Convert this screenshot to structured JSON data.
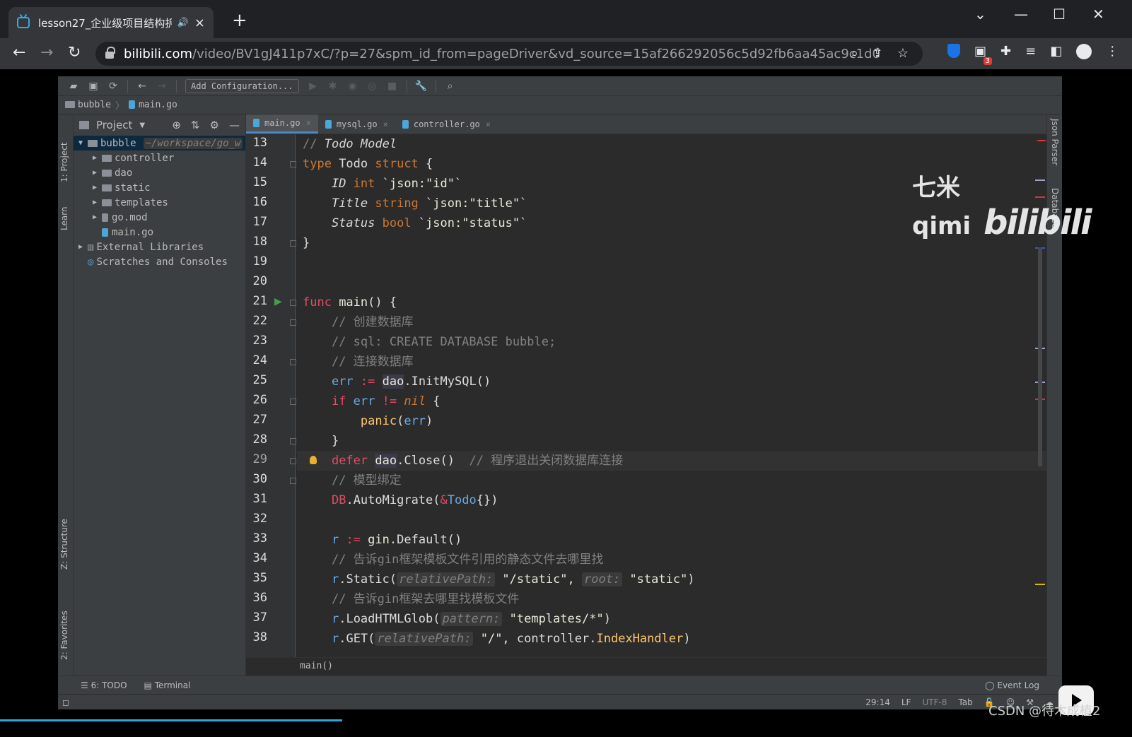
{
  "browser": {
    "tab_title": "lesson27_企业级项目结构拆",
    "new_tab": "+",
    "window_controls": [
      "chevron-down",
      "minimize",
      "maximize",
      "close"
    ],
    "url_host": "bilibili.com",
    "url_path": "/video/BV1gJ411p7xC/?p=27&spm_id_from=pageDriver&vd_source=15af266292056c5d92fb6aa45ac9c1d0",
    "extension_badge": "3"
  },
  "ide": {
    "toolbar": {
      "add_config": "Add Configuration..."
    },
    "breadcrumb": [
      "bubble",
      "main.go"
    ],
    "left_tool_labels": [
      "1: Project",
      "Learn",
      "Z: Structure",
      "2: Favorites"
    ],
    "right_tool_labels": [
      "Json Parser",
      "Database"
    ],
    "project_panel": {
      "title": "Project",
      "tree": [
        {
          "name": "bubble",
          "hint": "~/workspace/go_w",
          "indent": 0,
          "arrow": "▼",
          "type": "folder",
          "selected": true
        },
        {
          "name": "controller",
          "indent": 1,
          "arrow": "▶",
          "type": "folder"
        },
        {
          "name": "dao",
          "indent": 1,
          "arrow": "▶",
          "type": "folder"
        },
        {
          "name": "static",
          "indent": 1,
          "arrow": "▶",
          "type": "folder"
        },
        {
          "name": "templates",
          "indent": 1,
          "arrow": "▶",
          "type": "folder"
        },
        {
          "name": "go.mod",
          "indent": 1,
          "arrow": "▶",
          "type": "file"
        },
        {
          "name": "main.go",
          "indent": 1,
          "arrow": "",
          "type": "gofile"
        },
        {
          "name": "External Libraries",
          "indent": 0,
          "arrow": "▶",
          "type": "lib"
        },
        {
          "name": "Scratches and Consoles",
          "indent": 0,
          "arrow": "",
          "type": "scratch"
        }
      ]
    },
    "tabs": [
      {
        "label": "main.go",
        "active": true
      },
      {
        "label": "mysql.go",
        "active": false
      },
      {
        "label": "controller.go",
        "active": false
      }
    ],
    "code_lines": [
      {
        "num": "13",
        "tokens": [
          [
            "cmt",
            "// "
          ],
          [
            "cmt-i",
            "Todo Model"
          ]
        ]
      },
      {
        "num": "14",
        "tokens": [
          [
            "kw",
            "type "
          ],
          [
            "id",
            "Todo "
          ],
          [
            "kw",
            "struct "
          ],
          [
            "id",
            "{"
          ]
        ]
      },
      {
        "num": "15",
        "tokens": [
          [
            "id",
            "    "
          ],
          [
            "fld",
            "ID "
          ],
          [
            "typ",
            "int "
          ],
          [
            "tag",
            "`json:\"id\"`"
          ]
        ]
      },
      {
        "num": "16",
        "tokens": [
          [
            "id",
            "    "
          ],
          [
            "fld",
            "Title "
          ],
          [
            "typ",
            "string "
          ],
          [
            "tag",
            "`json:\"title\"`"
          ]
        ]
      },
      {
        "num": "17",
        "tokens": [
          [
            "id",
            "    "
          ],
          [
            "fld",
            "Status "
          ],
          [
            "typ",
            "bool "
          ],
          [
            "tag",
            "`json:\"status\"`"
          ]
        ]
      },
      {
        "num": "18",
        "tokens": [
          [
            "id",
            "}"
          ]
        ]
      },
      {
        "num": "19",
        "tokens": []
      },
      {
        "num": "20",
        "tokens": []
      },
      {
        "num": "21",
        "tokens": [
          [
            "kwr",
            "func "
          ],
          [
            "fn",
            "main"
          ],
          [
            "id",
            "() {"
          ]
        ]
      },
      {
        "num": "22",
        "tokens": [
          [
            "id",
            "    "
          ],
          [
            "cmt",
            "// 创建数据库"
          ]
        ]
      },
      {
        "num": "23",
        "tokens": [
          [
            "id",
            "    "
          ],
          [
            "cmt",
            "// sql: CREATE DATABASE bubble;"
          ]
        ]
      },
      {
        "num": "24",
        "tokens": [
          [
            "id",
            "    "
          ],
          [
            "cmt",
            "// 连接数据库"
          ]
        ]
      },
      {
        "num": "25",
        "tokens": [
          [
            "id",
            "    "
          ],
          [
            "var",
            "err "
          ],
          [
            "kwr",
            ":= "
          ],
          [
            "pkg",
            "dao"
          ],
          [
            "id",
            "."
          ],
          [
            "meth",
            "InitMySQL"
          ],
          [
            "id",
            "()"
          ]
        ]
      },
      {
        "num": "26",
        "tokens": [
          [
            "id",
            "    "
          ],
          [
            "kwr",
            "if "
          ],
          [
            "var",
            "err "
          ],
          [
            "kwr",
            "!= "
          ],
          [
            "nil",
            "nil "
          ],
          [
            "id",
            "{"
          ]
        ]
      },
      {
        "num": "27",
        "tokens": [
          [
            "id",
            "        "
          ],
          [
            "panic",
            "panic"
          ],
          [
            "id",
            "("
          ],
          [
            "var",
            "err"
          ],
          [
            "id",
            ")"
          ]
        ]
      },
      {
        "num": "28",
        "tokens": [
          [
            "id",
            "    }"
          ]
        ]
      },
      {
        "num": "29",
        "tokens": [
          [
            "id",
            "    "
          ],
          [
            "kwr",
            "defer "
          ],
          [
            "pkg",
            "dao"
          ],
          [
            "id",
            "."
          ],
          [
            "meth",
            "Close"
          ],
          [
            "id",
            "()  "
          ],
          [
            "cmt",
            "// 程序退出关闭数据库连接"
          ]
        ],
        "current": true
      },
      {
        "num": "30",
        "tokens": [
          [
            "id",
            "    "
          ],
          [
            "cmt",
            "// 模型绑定"
          ]
        ]
      },
      {
        "num": "31",
        "tokens": [
          [
            "id",
            "    "
          ],
          [
            "glob",
            "DB"
          ],
          [
            "id",
            "."
          ],
          [
            "meth",
            "AutoMigrate"
          ],
          [
            "id",
            "("
          ],
          [
            "kwr",
            "&"
          ],
          [
            "var",
            "Todo"
          ],
          [
            "id",
            "{})"
          ]
        ]
      },
      {
        "num": "32",
        "tokens": []
      },
      {
        "num": "33",
        "tokens": [
          [
            "id",
            "    "
          ],
          [
            "var",
            "r "
          ],
          [
            "kwr",
            ":= "
          ],
          [
            "fn",
            "gin"
          ],
          [
            "id",
            "."
          ],
          [
            "meth",
            "Default"
          ],
          [
            "id",
            "()"
          ]
        ]
      },
      {
        "num": "34",
        "tokens": [
          [
            "id",
            "    "
          ],
          [
            "cmt",
            "// 告诉gin框架模板文件引用的静态文件去哪里找"
          ]
        ]
      },
      {
        "num": "35",
        "tokens": [
          [
            "id",
            "    "
          ],
          [
            "var",
            "r"
          ],
          [
            "id",
            "."
          ],
          [
            "meth",
            "Static"
          ],
          [
            "id",
            "("
          ],
          [
            "hint",
            "relativePath:"
          ],
          [
            "str",
            " \"/static\", "
          ],
          [
            "hint",
            "root:"
          ],
          [
            "str",
            " \"static\""
          ],
          [
            "id",
            ")"
          ]
        ]
      },
      {
        "num": "36",
        "tokens": [
          [
            "id",
            "    "
          ],
          [
            "cmt",
            "// 告诉gin框架去哪里找模板文件"
          ]
        ]
      },
      {
        "num": "37",
        "tokens": [
          [
            "id",
            "    "
          ],
          [
            "var",
            "r"
          ],
          [
            "id",
            "."
          ],
          [
            "meth",
            "LoadHTMLGlob"
          ],
          [
            "id",
            "("
          ],
          [
            "hint",
            "pattern:"
          ],
          [
            "str",
            " \"templates/*\""
          ],
          [
            "id",
            ")"
          ]
        ]
      },
      {
        "num": "38",
        "tokens": [
          [
            "id",
            "    "
          ],
          [
            "var",
            "r"
          ],
          [
            "id",
            "."
          ],
          [
            "meth",
            "GET"
          ],
          [
            "id",
            "("
          ],
          [
            "hint",
            "relativePath:"
          ],
          [
            "str",
            " \"/\", "
          ],
          [
            "id",
            "controller."
          ],
          [
            "panic",
            "IndexHandler"
          ],
          [
            "id",
            ")"
          ]
        ]
      }
    ],
    "bottom_crumb": "main()",
    "tool_windows": {
      "todo": "6: TODO",
      "terminal": "Terminal",
      "event_log": "Event Log"
    },
    "status": {
      "position": "29:14",
      "line_sep": "LF",
      "encoding": "UTF-8",
      "indent": "Tab"
    }
  },
  "watermark": {
    "text": "七米qimi",
    "brand": "bilibili"
  },
  "credit": "CSDN @待木成植2",
  "colors": {
    "accent": "#4a88c7",
    "error": "#e53935",
    "progress": "#2aa7e0"
  }
}
